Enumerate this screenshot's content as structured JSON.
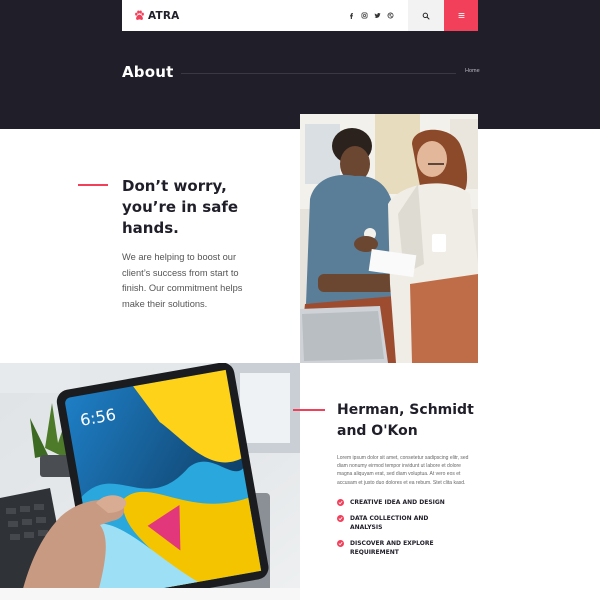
{
  "brand": {
    "name": "ATRA",
    "accent_color": "#f2405a",
    "dark_color": "#201e28"
  },
  "nav": {
    "social_icons": [
      "facebook-icon",
      "instagram-icon",
      "twitter-icon",
      "dribbble-icon"
    ],
    "search_icon": "search-icon",
    "menu_icon": "hamburger-menu-icon"
  },
  "hero": {
    "title": "About",
    "breadcrumb": "Home"
  },
  "section1": {
    "heading": "Don’t worry, you’re in safe hands.",
    "text": "We are helping to boost our client’s success from start to finish. Our commitment helps make their solutions.",
    "image": "two-people-with-coffee-photo"
  },
  "section2": {
    "heading": "Herman, Schmidt and O'Kon",
    "text": "Lorem ipsum dolor sit amet, consetetur sadipscing elitr, sed diam nonumy eirmod tempor invidunt ut labore et dolore magna aliquyam erat, sed diam voluptua. At vero eos et accusam et justo duo dolores et ea rebum. Stet clita kasd.",
    "image": "hand-holding-tablet-photo",
    "tablet_time": "6:56",
    "features": [
      "CREATIVE IDEA AND DESIGN",
      "DATA COLLECTION AND ANALYSIS",
      "DISCOVER AND EXPLORE REQUIREMENT"
    ]
  }
}
